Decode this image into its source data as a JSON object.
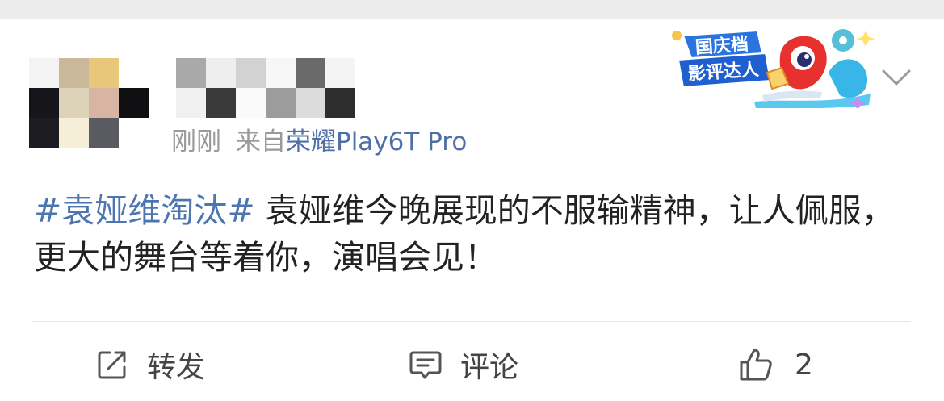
{
  "post": {
    "meta": {
      "time": "刚刚",
      "source_prefix": "来自",
      "device": "荣耀Play6T Pro"
    },
    "badge": {
      "line1": "国庆档",
      "line2": "影评达人"
    },
    "content": {
      "hashtag": "#袁娅维淘汰#",
      "text": " 袁娅维今晚展现的不服输精神，让人佩服，更大的舞台等着你，演唱会见！"
    }
  },
  "actions": {
    "repost_label": "转发",
    "comment_label": "评论",
    "like_count": "2"
  },
  "colors": {
    "hashtag": "#4d76b0",
    "device": "#4f6fa6",
    "meta_gray": "#9a9a9a",
    "text": "#222222"
  }
}
